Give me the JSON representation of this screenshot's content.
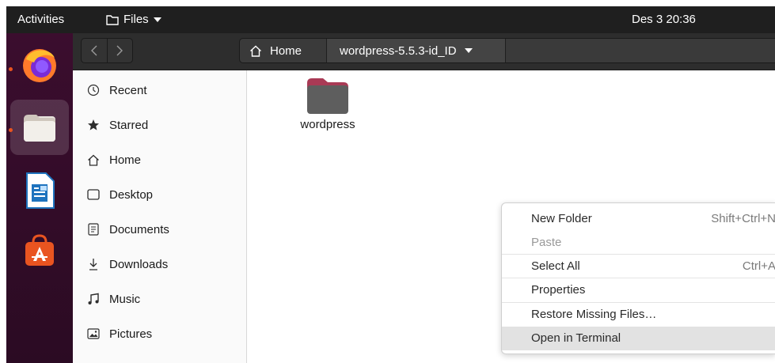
{
  "topbar": {
    "activities": "Activities",
    "app_menu": "Files",
    "clock": "Des 3  20:36"
  },
  "dock": {
    "apps": [
      {
        "name": "Firefox",
        "icon": "firefox-icon",
        "running": true
      },
      {
        "name": "Files",
        "icon": "files-icon",
        "running": true,
        "active": true
      },
      {
        "name": "LibreOffice Writer",
        "icon": "writer-icon",
        "running": false
      },
      {
        "name": "Ubuntu Software",
        "icon": "software-center-icon",
        "running": false
      }
    ]
  },
  "path": {
    "home": "Home",
    "current": "wordpress-5.5.3-id_ID"
  },
  "sidebar": {
    "items": [
      {
        "label": "Recent",
        "icon": "clock-icon"
      },
      {
        "label": "Starred",
        "icon": "star-icon"
      },
      {
        "label": "Home",
        "icon": "home-icon"
      },
      {
        "label": "Desktop",
        "icon": "desktop-icon"
      },
      {
        "label": "Documents",
        "icon": "document-icon"
      },
      {
        "label": "Downloads",
        "icon": "download-icon"
      },
      {
        "label": "Music",
        "icon": "music-icon"
      },
      {
        "label": "Pictures",
        "icon": "picture-icon"
      }
    ]
  },
  "content": {
    "items": [
      {
        "name": "wordpress",
        "type": "folder"
      }
    ]
  },
  "context_menu": {
    "items": [
      {
        "label": "New Folder",
        "shortcut": "Shift+Ctrl+N",
        "enabled": true
      },
      {
        "label": "Paste",
        "shortcut": "",
        "enabled": false
      },
      {
        "label": "Select All",
        "shortcut": "Ctrl+A",
        "enabled": true
      },
      {
        "label": "Properties",
        "shortcut": "",
        "enabled": true
      },
      {
        "label": "Restore Missing Files…",
        "shortcut": "",
        "enabled": true
      },
      {
        "label": "Open in Terminal",
        "shortcut": "",
        "enabled": true,
        "highlighted": true
      }
    ]
  },
  "colors": {
    "topbar": "#1f1f1f",
    "dock": "#2b0b23",
    "accent": "#e95420",
    "folder": "#5e5e5e",
    "folder_tab": "#a93a55"
  }
}
